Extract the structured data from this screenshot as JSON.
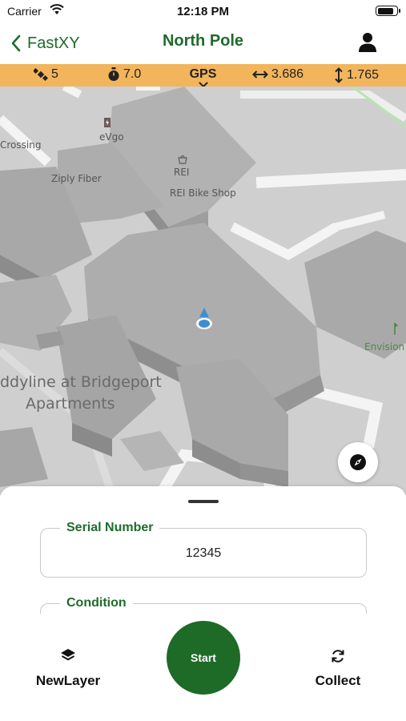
{
  "status_bar": {
    "carrier": "Carrier",
    "time": "12:18 PM",
    "battery_level": 0.9
  },
  "nav": {
    "back_label": "FastXY",
    "title": "North Pole"
  },
  "gps_bar": {
    "satellites": "5",
    "accuracy": "7.0",
    "mode": "GPS",
    "horizontal": "3.686",
    "vertical": "1.765"
  },
  "map": {
    "labels": {
      "crossing": "Crossing",
      "evgo": "eVgo",
      "ziply": "Ziply Fiber",
      "rei": "REI",
      "rei_bike": "REI Bike Shop",
      "envision": "Envision",
      "apartments_line1": "ddyline at Bridgeport",
      "apartments_line2": "Apartments"
    }
  },
  "form": {
    "serial_label": "Serial Number",
    "serial_value": "12345",
    "condition_label": "Condition"
  },
  "toolbar": {
    "new_layer": "NewLayer",
    "start": "Start",
    "collect": "Collect"
  }
}
